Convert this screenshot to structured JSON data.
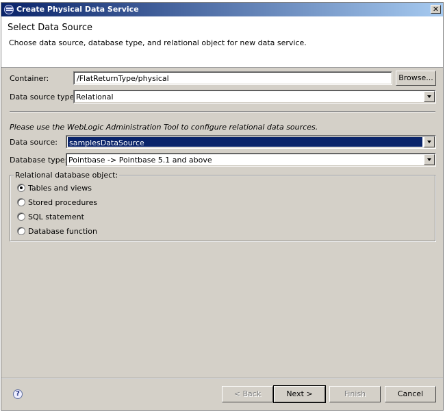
{
  "window": {
    "title": "Create Physical Data Service",
    "close_glyph": "✕"
  },
  "header": {
    "title": "Select Data Source",
    "description": "Choose data source, database type, and relational object for new data service."
  },
  "form": {
    "container_label": "Container:",
    "container_value": "/FlatReturnType/physical",
    "browse_label": "Browse...",
    "datasource_type_label": "Data source type:",
    "datasource_type_value": "Relational",
    "info_text": "Please use the WebLogic Administration Tool to configure relational data sources.",
    "datasource_label": "Data source:",
    "datasource_value": "samplesDataSource",
    "dbtype_label": "Database type:",
    "dbtype_value": "Pointbase -> Pointbase 5.1 and above"
  },
  "relational_group": {
    "legend": "Relational database object:",
    "options": [
      {
        "label": "Tables and views",
        "selected": true
      },
      {
        "label": "Stored procedures",
        "selected": false
      },
      {
        "label": "SQL statement",
        "selected": false
      },
      {
        "label": "Database function",
        "selected": false
      }
    ]
  },
  "footer": {
    "help_glyph": "?",
    "back_label": "< Back",
    "next_label": "Next >",
    "finish_label": "Finish",
    "cancel_label": "Cancel"
  }
}
